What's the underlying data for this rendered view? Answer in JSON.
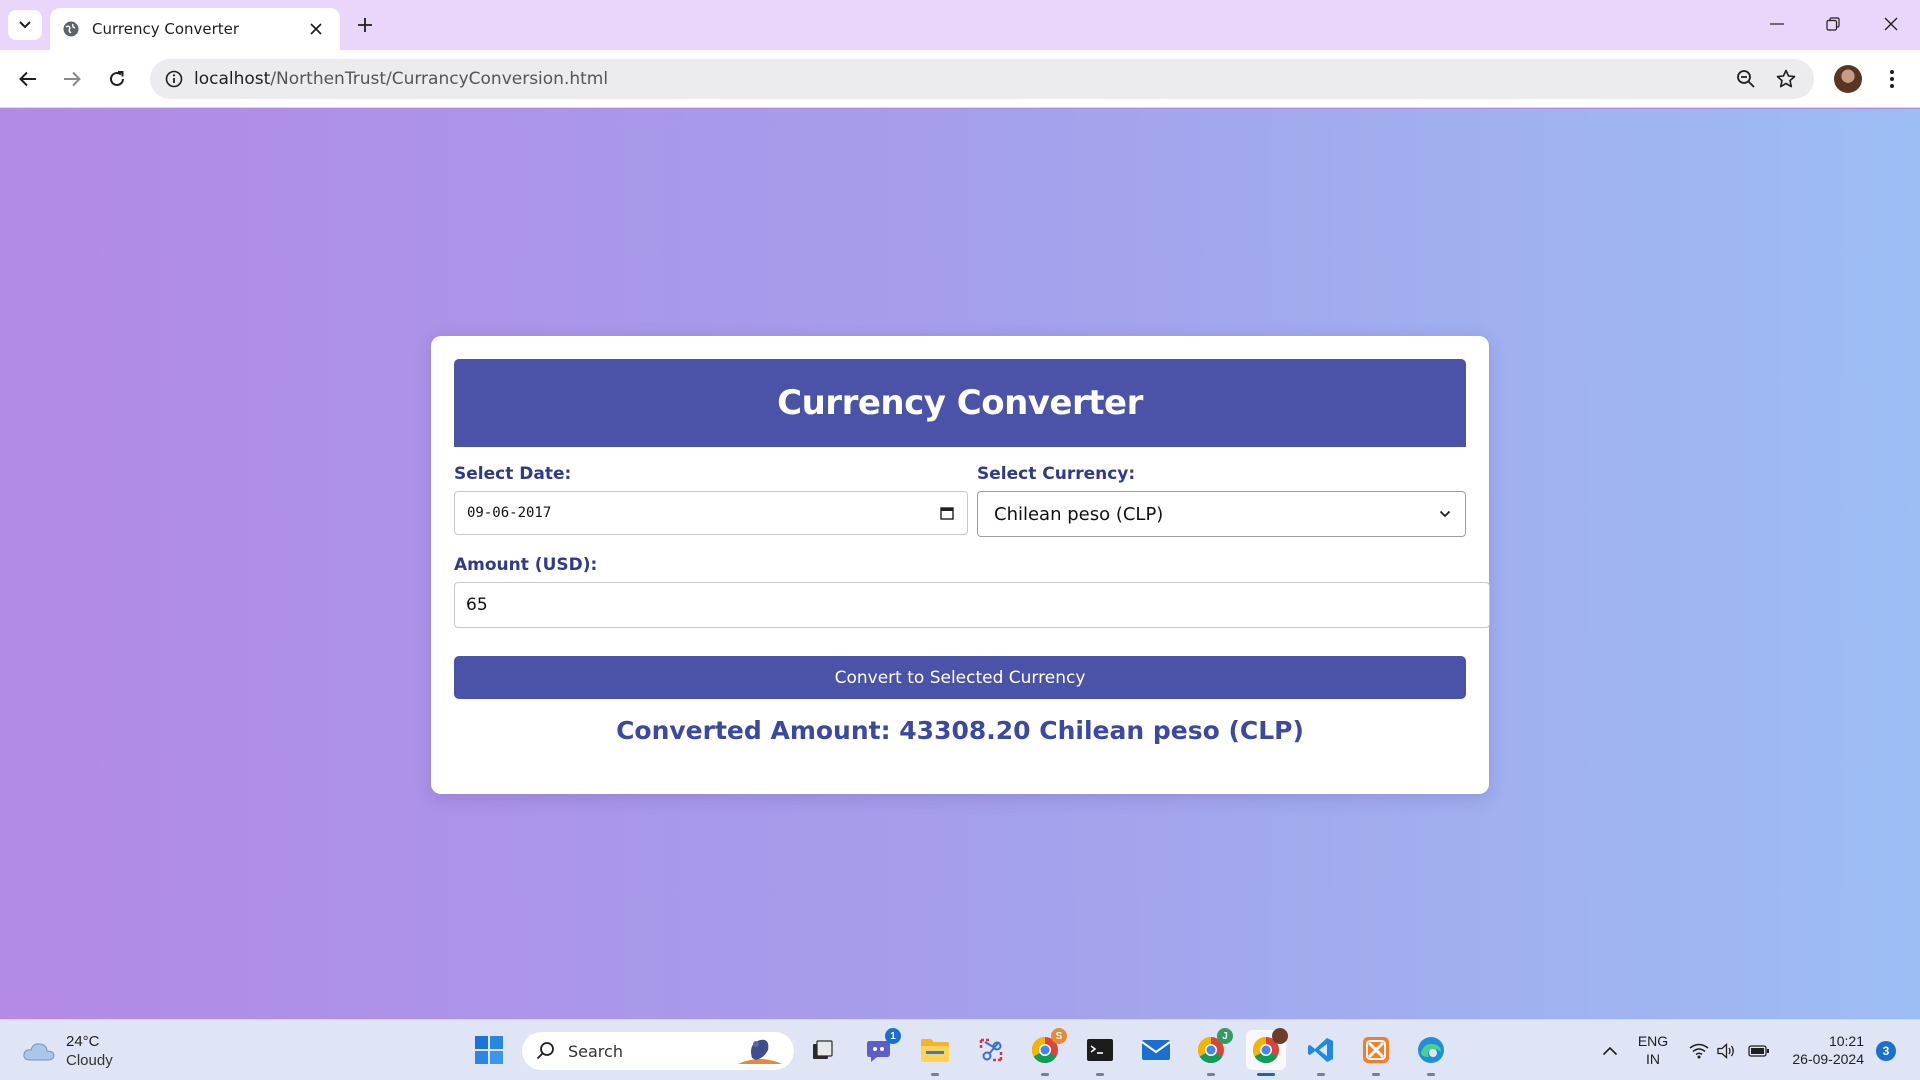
{
  "browser": {
    "tab_title": "Currency Converter",
    "url_host": "localhost",
    "url_path": "/NorthenTrust/CurrancyConversion.html"
  },
  "page": {
    "heading": "Currency Converter",
    "date_label": "Select Date:",
    "date_value": "09-06-2017",
    "currency_label": "Select Currency:",
    "currency_selected": "Chilean peso (CLP)",
    "amount_label": "Amount (USD):",
    "amount_value": "65",
    "convert_button": "Convert to Selected Currency",
    "result_text": "Converted Amount: 43308.20 Chilean peso (CLP)"
  },
  "colors": {
    "accent": "#4b53a9",
    "label": "#2f3a8f",
    "result": "#3c48a2",
    "bg_left": "#b389e6",
    "bg_right": "#9dbdf5"
  },
  "taskbar": {
    "weather_temp": "24°C",
    "weather_condition": "Cloudy",
    "search_placeholder": "Search",
    "lang_primary": "ENG",
    "lang_region": "IN",
    "time": "10:21",
    "date": "26-09-2024",
    "notification_count": "3",
    "teams_badge": "1",
    "chrome_s_badge": "S",
    "chrome_j_badge": "J",
    "apps": [
      "start-icon",
      "task-view-icon",
      "teams-icon",
      "file-explorer-icon",
      "snipping-tool-icon",
      "chrome-profile-s-icon",
      "terminal-icon",
      "mail-icon",
      "chrome-profile-j-icon",
      "chrome-active-icon",
      "vscode-icon",
      "xampp-icon",
      "edge-icon"
    ]
  }
}
